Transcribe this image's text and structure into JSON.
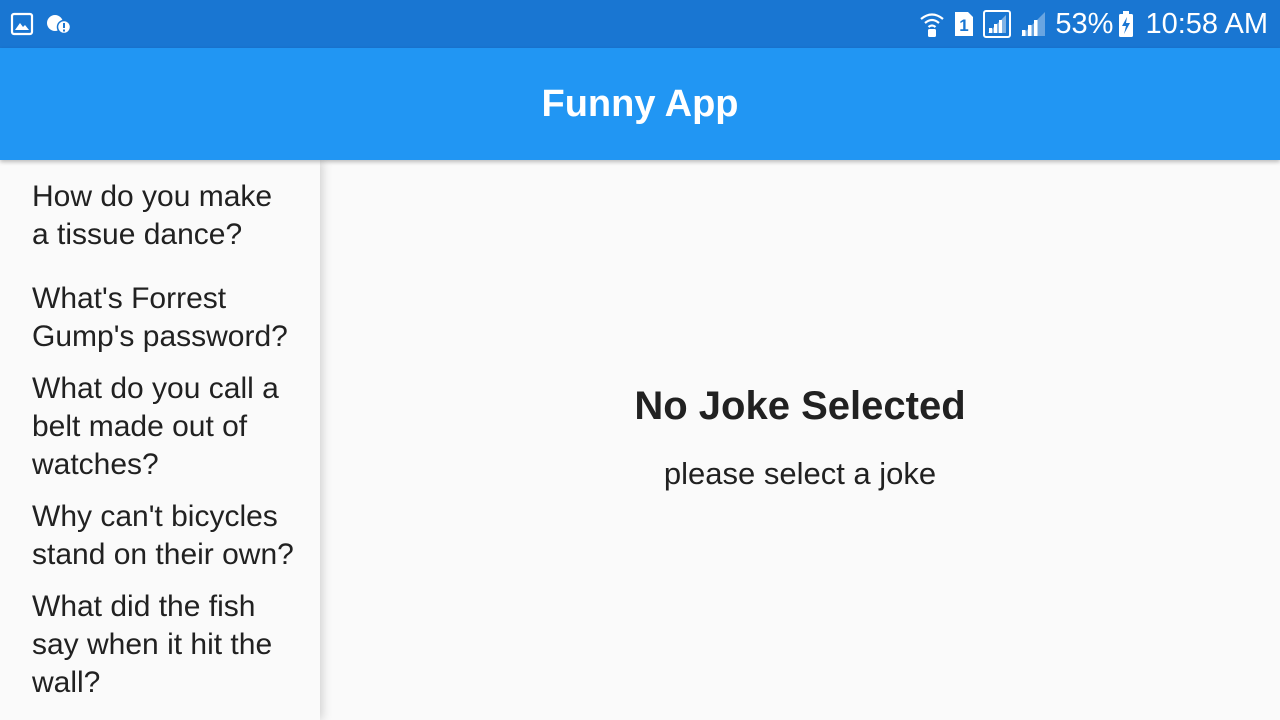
{
  "status_bar": {
    "battery_percent": "53%",
    "time": "10:58 AM",
    "sim_slot": "1",
    "left_icons": [
      "gallery-notification-icon",
      "weather-alert-icon"
    ],
    "right_icons": [
      "wifi-calling-icon",
      "sim-1-icon",
      "signal-sim1-icon",
      "signal-sim2-icon",
      "battery-charging-icon"
    ],
    "colors": {
      "background": "#1976d2",
      "foreground": "#ffffff"
    }
  },
  "app_bar": {
    "title": "Funny App",
    "color": "#2196f3"
  },
  "joke_list": {
    "items": [
      {
        "question": "How do you make a tissue dance?"
      },
      {
        "question": "What's Forrest Gump's password?"
      },
      {
        "question": "What do you call a belt made out of watches?"
      },
      {
        "question": "Why can't bicycles stand on their own?"
      },
      {
        "question": "What did the fish say when it hit the wall?"
      }
    ]
  },
  "detail": {
    "title": "No Joke Selected",
    "subtitle": "please select a joke"
  }
}
